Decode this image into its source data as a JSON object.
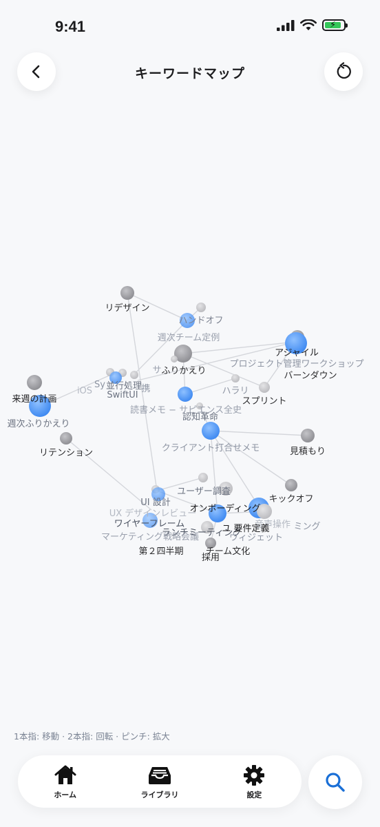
{
  "status": {
    "time": "9:41"
  },
  "header": {
    "title": "キーワードマップ"
  },
  "hint": "1本指: 移動 · 2本指: 回転 · ピンチ: 拡大",
  "tabs": [
    {
      "label": "ホーム",
      "icon": "house-icon"
    },
    {
      "label": "ライブラリ",
      "icon": "tray-icon"
    },
    {
      "label": "設定",
      "icon": "gear-icon"
    }
  ],
  "graph": {
    "labels": [
      "リデザイン",
      "ハンドオフ",
      "週次チーム定例",
      "アジャイル",
      "ふりかえり",
      "サ",
      "プロジェクト管理ワークショップ",
      "バーンダウン",
      "並行処理",
      "Sy",
      "携",
      "SwiftUI",
      "iOS",
      "来週の計画",
      "ハラリ",
      "スプリント",
      "読書メモ − サピエンス全史",
      "認知革命",
      "週次ふりかえり",
      "リテンション",
      "クライアント打合せメモ",
      "見積もり",
      "ユーザー調査",
      "キックオフ",
      "UI 設計",
      "オンボーディング",
      "UX デザインレビュー",
      "ワイヤーフレーム",
      "ランチミーティング",
      "ユ 要件定義",
      "音声操作",
      "ミング",
      "ウィジェット",
      "マーケティング戦略会議",
      "第２四半期",
      "チーム文化",
      "採用"
    ]
  },
  "colors": {
    "accent": "#3b82f6",
    "node_gray": "#9a9a9f",
    "edge": "#d4d6db"
  }
}
